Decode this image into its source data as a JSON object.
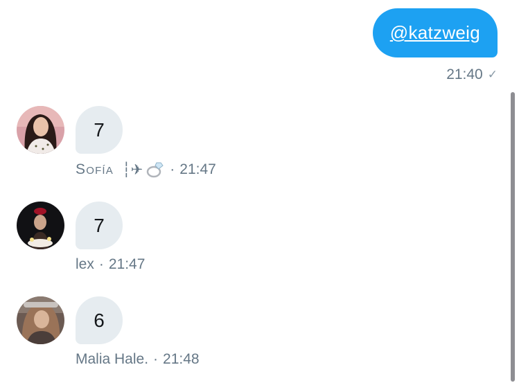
{
  "conversation": {
    "outgoing": {
      "text": "@katzweig",
      "time": "21:40",
      "status_icon": "check-icon"
    },
    "messages": [
      {
        "text": "7",
        "sender": "Sofía",
        "sender_suffix": "┆✈",
        "emoji_icon": "ring-icon",
        "separator": "·",
        "time": "21:47"
      },
      {
        "text": "7",
        "sender": "lex",
        "separator": "·",
        "time": "21:47"
      },
      {
        "text": "6",
        "sender": "Malia Hale.",
        "separator": "·",
        "time": "21:48"
      }
    ]
  },
  "colors": {
    "outgoing_bubble": "#1da1f2",
    "incoming_bubble": "#e6ecf0",
    "meta_text": "#657786",
    "message_text": "#14171a"
  }
}
